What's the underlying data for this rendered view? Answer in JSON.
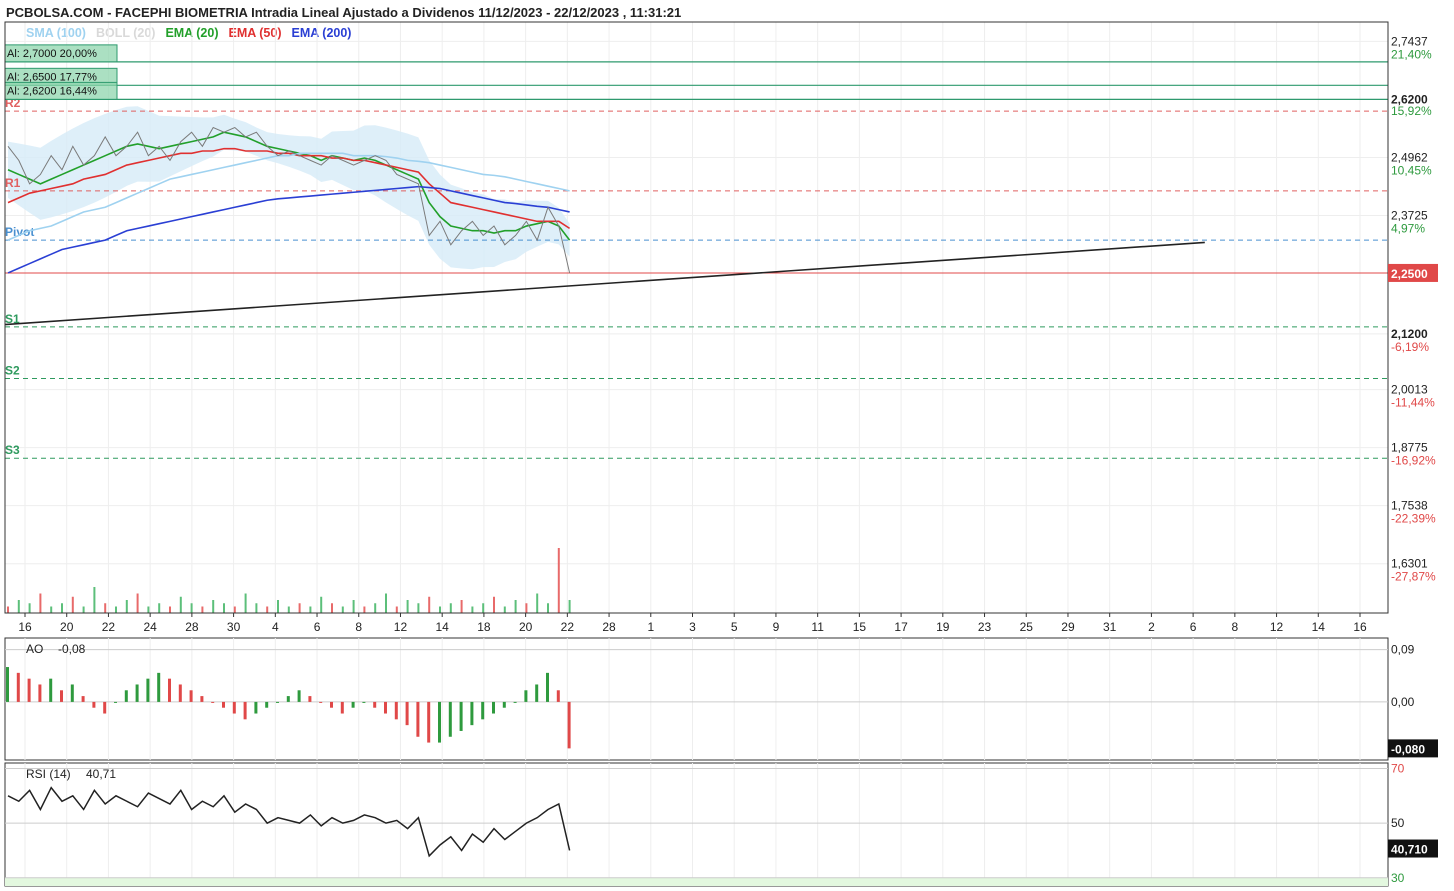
{
  "header": {
    "title": "PCBOLSA.COM - FACEPHI BIOMETRIA Intradia Lineal Ajustado a Dividenos 11/12/2023 - 22/12/2023 , 11:31:21"
  },
  "legend": [
    {
      "label": "SMA (100)",
      "color": "#9fd2f0"
    },
    {
      "label": "BOLL (20)",
      "color": "#d9d9d9"
    },
    {
      "label": "EMA (20)",
      "color": "#22a02a"
    },
    {
      "label": "EMA (50)",
      "color": "#e03030"
    },
    {
      "label": "EMA (200)",
      "color": "#2a3fd4"
    }
  ],
  "alerts": [
    {
      "label": "Al: 2,7000  20,00%",
      "price": 2.7
    },
    {
      "label": "Al: 2,6500  17,77%",
      "price": 2.65
    },
    {
      "label": "Al: 2,6200  16,44%",
      "price": 2.62
    }
  ],
  "chart_data": {
    "type": "line",
    "price_axis": {
      "ticks": [
        {
          "value": 2.7437,
          "label": "2,7437",
          "pct": "21,40%"
        },
        {
          "value": 2.62,
          "label": "2,6200",
          "pct": "",
          "bold": true
        },
        {
          "value": 2.595,
          "label": "",
          "pct": "15,92%"
        },
        {
          "value": 2.4962,
          "label": "2,4962",
          "pct": "10,45%"
        },
        {
          "value": 2.3725,
          "label": "2,3725",
          "pct": "4,97%"
        },
        {
          "value": 2.12,
          "label": "2,1200",
          "pct": "-6,19%",
          "bold": true
        },
        {
          "value": 2.0013,
          "label": "2,0013",
          "pct": "-11,44%"
        },
        {
          "value": 1.8775,
          "label": "1,8775",
          "pct": "-16,92%"
        },
        {
          "value": 1.7538,
          "label": "1,7538",
          "pct": "-22,39%"
        },
        {
          "value": 1.6301,
          "label": "1,6301",
          "pct": "-27,87%"
        }
      ],
      "current": {
        "value": 2.25,
        "label": "2,2500",
        "color": "#e04848"
      },
      "range": [
        1.525,
        2.785
      ]
    },
    "x_ticks": [
      "16",
      "20",
      "22",
      "24",
      "28",
      "30",
      "4",
      "6",
      "8",
      "12",
      "14",
      "18",
      "20",
      "22",
      "28",
      "1",
      "3",
      "5",
      "9",
      "11",
      "15",
      "17",
      "19",
      "23",
      "25",
      "29",
      "31",
      "2",
      "6",
      "8",
      "12",
      "14",
      "16"
    ],
    "pivots": [
      {
        "name": "R2",
        "value": 2.595,
        "color": "#e06060"
      },
      {
        "name": "R1",
        "value": 2.425,
        "color": "#e06060"
      },
      {
        "name": "Pivot",
        "value": 2.32,
        "color": "#4a90d0"
      },
      {
        "name": "S1",
        "value": 2.135,
        "color": "#2e9a5e"
      },
      {
        "name": "S2",
        "value": 2.025,
        "color": "#2e9a5e"
      },
      {
        "name": "S3",
        "value": 1.855,
        "color": "#2e9a5e"
      }
    ],
    "series": [
      {
        "key": "ema20",
        "color": "#22a02a",
        "values": [
          2.47,
          2.46,
          2.45,
          2.44,
          2.45,
          2.46,
          2.47,
          2.48,
          2.49,
          2.5,
          2.51,
          2.52,
          2.525,
          2.52,
          2.515,
          2.52,
          2.525,
          2.53,
          2.535,
          2.54,
          2.55,
          2.545,
          2.54,
          2.53,
          2.52,
          2.515,
          2.51,
          2.505,
          2.5,
          2.49,
          2.5,
          2.495,
          2.49,
          2.495,
          2.49,
          2.48,
          2.47,
          2.46,
          2.45,
          2.4,
          2.37,
          2.35,
          2.345,
          2.34,
          2.34,
          2.335,
          2.34,
          2.34,
          2.35,
          2.355,
          2.36,
          2.35,
          2.32
        ]
      },
      {
        "key": "ema50",
        "color": "#e03030",
        "values": [
          2.4,
          2.41,
          2.42,
          2.425,
          2.43,
          2.435,
          2.44,
          2.45,
          2.455,
          2.46,
          2.47,
          2.48,
          2.485,
          2.49,
          2.495,
          2.5,
          2.505,
          2.505,
          2.51,
          2.51,
          2.515,
          2.515,
          2.51,
          2.51,
          2.51,
          2.505,
          2.505,
          2.5,
          2.5,
          2.5,
          2.495,
          2.495,
          2.49,
          2.49,
          2.485,
          2.48,
          2.475,
          2.47,
          2.465,
          2.44,
          2.42,
          2.4,
          2.395,
          2.39,
          2.385,
          2.38,
          2.375,
          2.37,
          2.365,
          2.36,
          2.36,
          2.36,
          2.345
        ]
      },
      {
        "key": "ema200",
        "color": "#2a3fd4",
        "values": [
          2.25,
          2.26,
          2.27,
          2.28,
          2.29,
          2.3,
          2.305,
          2.31,
          2.315,
          2.32,
          2.33,
          2.34,
          2.345,
          2.35,
          2.355,
          2.36,
          2.365,
          2.37,
          2.375,
          2.38,
          2.385,
          2.39,
          2.395,
          2.4,
          2.405,
          2.408,
          2.41,
          2.412,
          2.414,
          2.416,
          2.418,
          2.42,
          2.422,
          2.424,
          2.426,
          2.428,
          2.43,
          2.432,
          2.434,
          2.432,
          2.43,
          2.425,
          2.42,
          2.415,
          2.41,
          2.405,
          2.4,
          2.398,
          2.395,
          2.392,
          2.39,
          2.385,
          2.38
        ]
      },
      {
        "key": "sma100",
        "color": "#9fd2f0",
        "values": [
          2.32,
          2.33,
          2.34,
          2.345,
          2.35,
          2.36,
          2.37,
          2.38,
          2.385,
          2.39,
          2.4,
          2.41,
          2.42,
          2.43,
          2.44,
          2.45,
          2.455,
          2.46,
          2.465,
          2.47,
          2.475,
          2.48,
          2.485,
          2.49,
          2.495,
          2.5,
          2.5,
          2.505,
          2.505,
          2.505,
          2.505,
          2.505,
          2.5,
          2.5,
          2.5,
          2.498,
          2.495,
          2.49,
          2.488,
          2.485,
          2.48,
          2.475,
          2.47,
          2.465,
          2.46,
          2.458,
          2.455,
          2.45,
          2.445,
          2.44,
          2.435,
          2.43,
          2.425
        ]
      },
      {
        "key": "price",
        "color": "#7a7a7a",
        "values": [
          2.52,
          2.49,
          2.44,
          2.46,
          2.5,
          2.47,
          2.52,
          2.48,
          2.5,
          2.54,
          2.5,
          2.52,
          2.55,
          2.5,
          2.52,
          2.49,
          2.53,
          2.55,
          2.52,
          2.56,
          2.55,
          2.56,
          2.54,
          2.55,
          2.52,
          2.5,
          2.51,
          2.5,
          2.49,
          2.48,
          2.5,
          2.49,
          2.48,
          2.49,
          2.5,
          2.49,
          2.46,
          2.45,
          2.44,
          2.33,
          2.36,
          2.31,
          2.34,
          2.36,
          2.33,
          2.35,
          2.31,
          2.33,
          2.36,
          2.32,
          2.39,
          2.35,
          2.25
        ]
      }
    ],
    "trendline": {
      "start": [
        0,
        2.14
      ],
      "end": [
        96,
        2.315
      ],
      "color": "#222222"
    },
    "volume": [
      2,
      4,
      3,
      6,
      2,
      3,
      5,
      2,
      8,
      3,
      2,
      4,
      6,
      2,
      3,
      2,
      5,
      3,
      2,
      4,
      3,
      2,
      6,
      3,
      2,
      4,
      2,
      3,
      2,
      5,
      3,
      2,
      4,
      2,
      3,
      6,
      2,
      4,
      3,
      5,
      2,
      3,
      4,
      2,
      3,
      5,
      2,
      4,
      3,
      6,
      3,
      20,
      4
    ],
    "oscillators": [
      {
        "name": "AO",
        "value_label": "-0,08",
        "ticks": [
          {
            "value": 0.09,
            "label": "0,09"
          },
          {
            "value": 0.0,
            "label": "0,00"
          }
        ],
        "current": {
          "value": -0.08,
          "label": "-0,080"
        },
        "range": [
          -0.1,
          0.11
        ],
        "values": [
          0.06,
          0.05,
          0.04,
          0.03,
          0.04,
          0.02,
          0.03,
          0.01,
          -0.01,
          -0.02,
          0.0,
          0.02,
          0.03,
          0.04,
          0.05,
          0.04,
          0.03,
          0.02,
          0.01,
          0.0,
          -0.01,
          -0.02,
          -0.03,
          -0.02,
          -0.01,
          0.0,
          0.01,
          0.02,
          0.01,
          0.0,
          -0.01,
          -0.02,
          -0.01,
          0.0,
          -0.01,
          -0.02,
          -0.03,
          -0.04,
          -0.06,
          -0.07,
          -0.07,
          -0.06,
          -0.05,
          -0.04,
          -0.03,
          -0.02,
          -0.01,
          0.0,
          0.02,
          0.03,
          0.05,
          0.02,
          -0.08
        ]
      },
      {
        "name": "RSI (14)",
        "value_label": "40,71",
        "ticks": [
          {
            "value": 70,
            "label": "70"
          },
          {
            "value": 50,
            "label": "50"
          },
          {
            "value": 30,
            "label": "30"
          }
        ],
        "current": {
          "value": 40.71,
          "label": "40,710"
        },
        "range": [
          27,
          72
        ],
        "values": [
          60,
          58,
          62,
          55,
          63,
          58,
          60,
          55,
          62,
          57,
          60,
          58,
          56,
          61,
          59,
          57,
          62,
          55,
          58,
          56,
          60,
          54,
          57,
          55,
          50,
          52,
          51,
          50,
          53,
          49,
          52,
          50,
          51,
          53,
          52,
          50,
          51,
          48,
          52,
          38,
          42,
          45,
          40,
          46,
          43,
          48,
          44,
          47,
          50,
          52,
          55,
          57,
          40
        ]
      }
    ]
  }
}
